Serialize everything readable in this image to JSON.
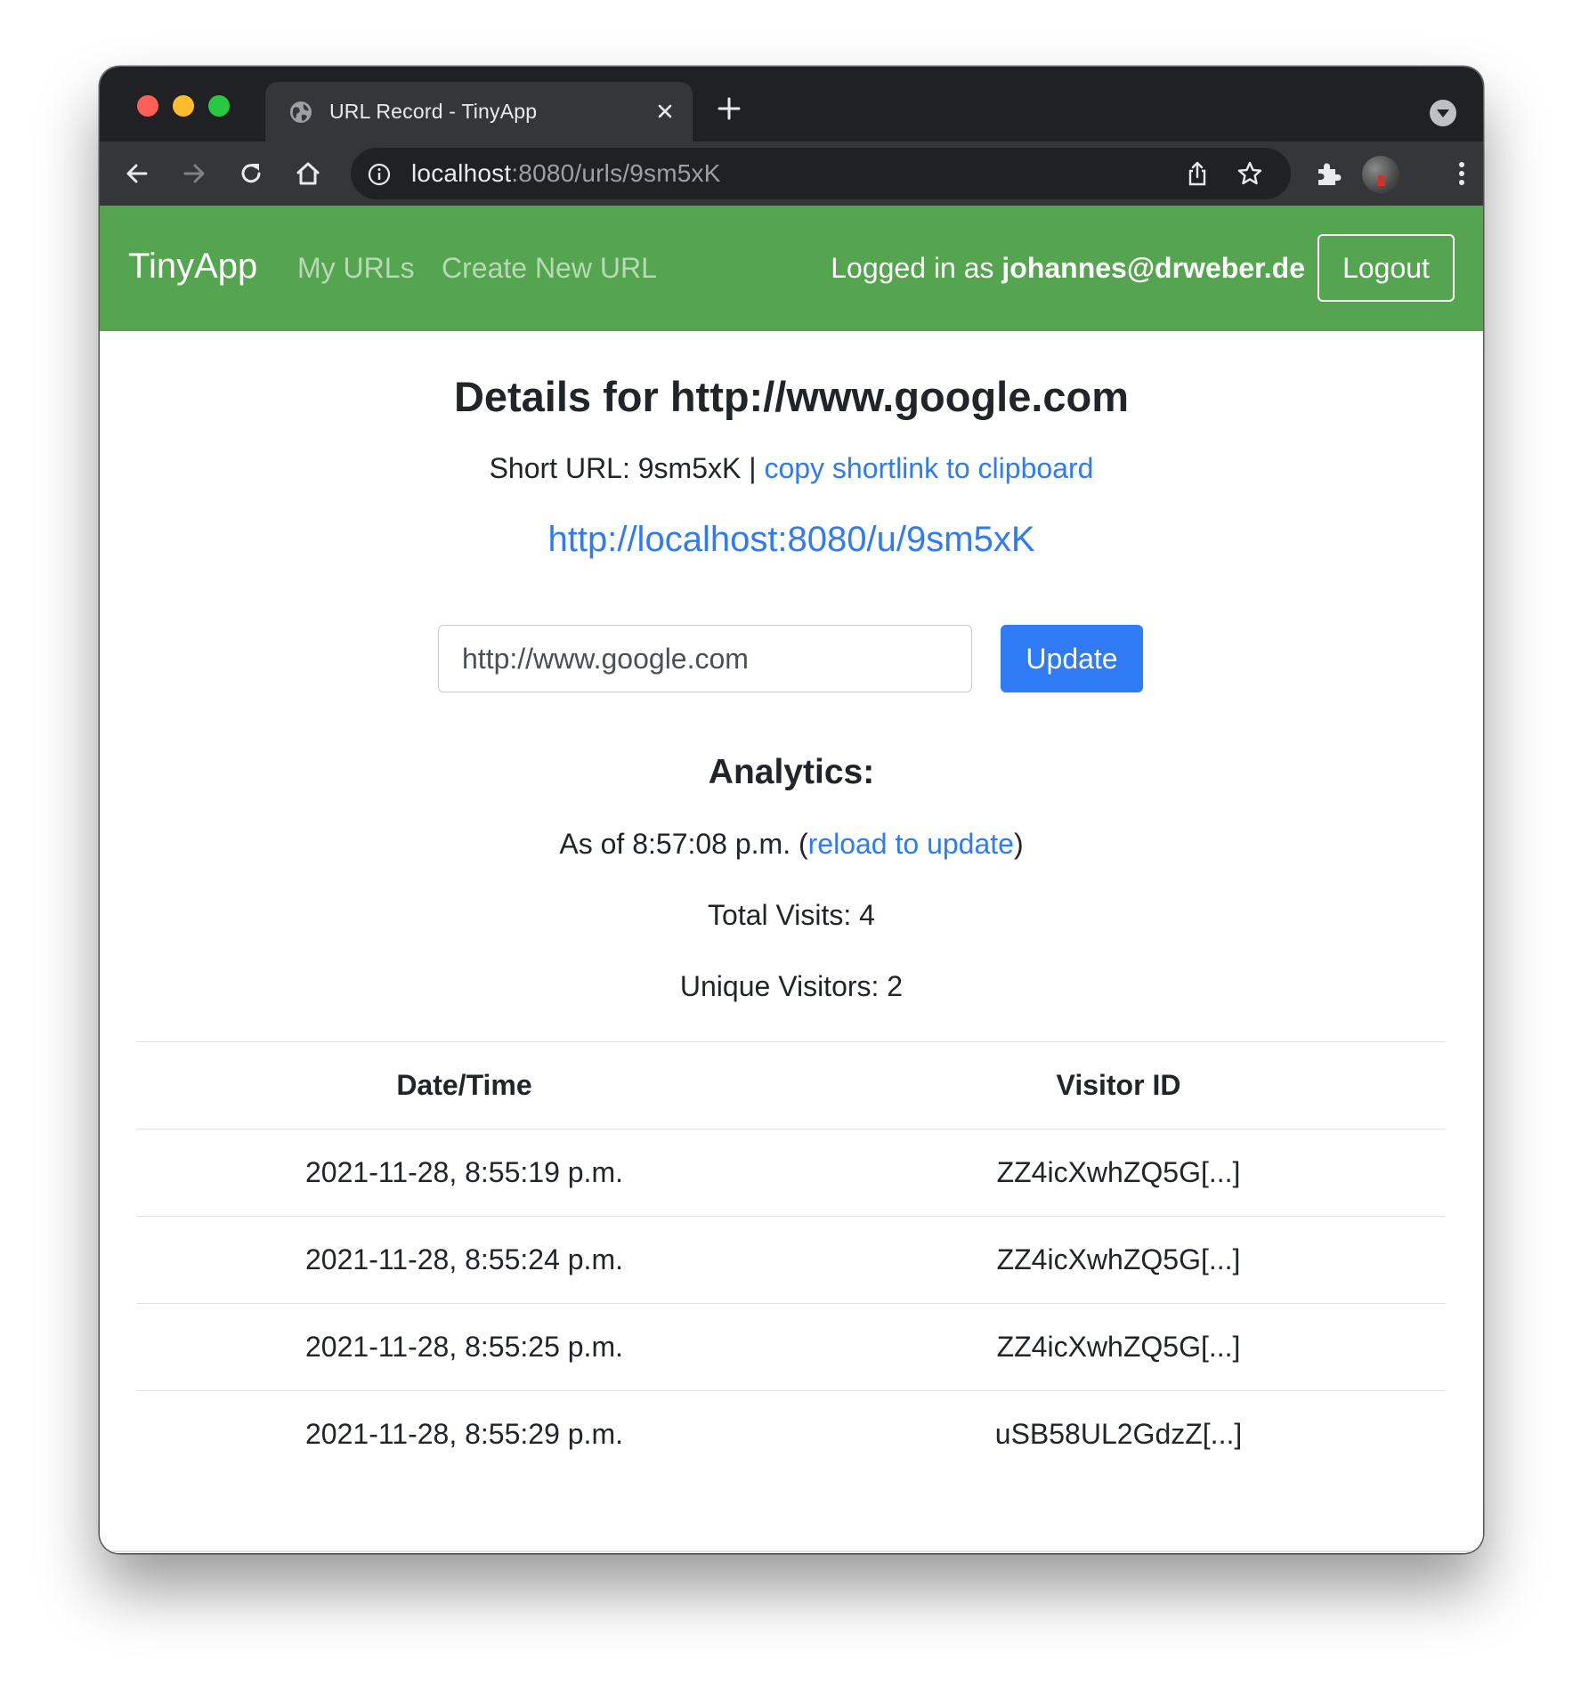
{
  "browser": {
    "tab_title": "URL Record - TinyApp",
    "address_host": "localhost",
    "address_path": ":8080/urls/9sm5xK"
  },
  "navbar": {
    "brand": "TinyApp",
    "links": [
      "My URLs",
      "Create New URL"
    ],
    "logged_in_prefix": "Logged in as ",
    "user_email": "johannes@drweber.de",
    "logout_label": "Logout",
    "bg_color": "#55a44f"
  },
  "details": {
    "heading": "Details for http://www.google.com",
    "short_url_prefix": "Short URL: 9sm5xK | ",
    "copy_link_label": "copy shortlink to clipboard",
    "short_link": "http://localhost:8080/u/9sm5xK",
    "input_value": "http://www.google.com",
    "update_label": "Update",
    "accent_color": "#2f7bf5"
  },
  "analytics": {
    "title": "Analytics:",
    "as_of_prefix": "As of 8:57:08 p.m. (",
    "reload_label": "reload to update",
    "as_of_suffix": ")",
    "total_visits": "Total Visits: 4",
    "unique_visitors": "Unique Visitors: 2",
    "table": {
      "headers": [
        "Date/Time",
        "Visitor ID"
      ],
      "rows": [
        [
          "2021-11-28, 8:55:19 p.m.",
          "ZZ4icXwhZQ5G[...]"
        ],
        [
          "2021-11-28, 8:55:24 p.m.",
          "ZZ4icXwhZQ5G[...]"
        ],
        [
          "2021-11-28, 8:55:25 p.m.",
          "ZZ4icXwhZQ5G[...]"
        ],
        [
          "2021-11-28, 8:55:29 p.m.",
          "uSB58UL2GdzZ[...]"
        ]
      ]
    }
  },
  "icons": [
    "globe-icon",
    "close-icon",
    "new-tab-icon",
    "tab-menu-icon",
    "back-icon",
    "forward-icon",
    "reload-icon",
    "home-icon",
    "info-icon",
    "share-icon",
    "star-icon",
    "extensions-icon",
    "avatar",
    "kebab-menu-icon"
  ]
}
